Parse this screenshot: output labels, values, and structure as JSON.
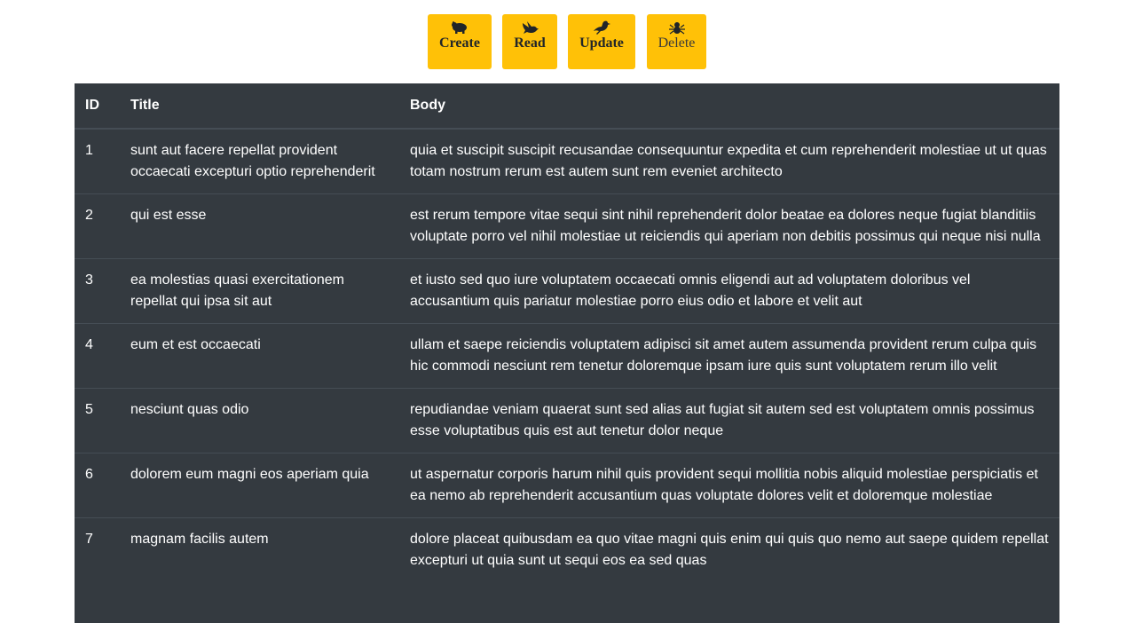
{
  "toolbar": {
    "buttons": [
      {
        "label": "Create",
        "icon": "hippo-icon"
      },
      {
        "label": "Read",
        "icon": "dove-icon"
      },
      {
        "label": "Update",
        "icon": "crow-icon"
      },
      {
        "label": "Delete",
        "icon": "spider-icon"
      }
    ],
    "accent_color": "#ffc107"
  },
  "table": {
    "headers": [
      "ID",
      "Title",
      "Body"
    ],
    "background_color": "#343a40",
    "rows": [
      {
        "id": "1",
        "title": "sunt aut facere repellat provident occaecati excepturi optio reprehenderit",
        "body": "quia et suscipit suscipit recusandae consequuntur expedita et cum reprehenderit molestiae ut ut quas totam nostrum rerum est autem sunt rem eveniet architecto"
      },
      {
        "id": "2",
        "title": "qui est esse",
        "body": "est rerum tempore vitae sequi sint nihil reprehenderit dolor beatae ea dolores neque fugiat blanditiis voluptate porro vel nihil molestiae ut reiciendis qui aperiam non debitis possimus qui neque nisi nulla"
      },
      {
        "id": "3",
        "title": "ea molestias quasi exercitationem repellat qui ipsa sit aut",
        "body": "et iusto sed quo iure voluptatem occaecati omnis eligendi aut ad voluptatem doloribus vel accusantium quis pariatur molestiae porro eius odio et labore et velit aut"
      },
      {
        "id": "4",
        "title": "eum et est occaecati",
        "body": "ullam et saepe reiciendis voluptatem adipisci sit amet autem assumenda provident rerum culpa quis hic commodi nesciunt rem tenetur doloremque ipsam iure quis sunt voluptatem rerum illo velit"
      },
      {
        "id": "5",
        "title": "nesciunt quas odio",
        "body": "repudiandae veniam quaerat sunt sed alias aut fugiat sit autem sed est voluptatem omnis possimus esse voluptatibus quis est aut tenetur dolor neque"
      },
      {
        "id": "6",
        "title": "dolorem eum magni eos aperiam quia",
        "body": "ut aspernatur corporis harum nihil quis provident sequi mollitia nobis aliquid molestiae perspiciatis et ea nemo ab reprehenderit accusantium quas voluptate dolores velit et doloremque molestiae"
      },
      {
        "id": "7",
        "title": "magnam facilis autem",
        "body": "dolore placeat quibusdam ea quo vitae magni quis enim qui quis quo nemo aut saepe quidem repellat excepturi ut quia sunt ut sequi eos ea sed quas"
      }
    ]
  }
}
